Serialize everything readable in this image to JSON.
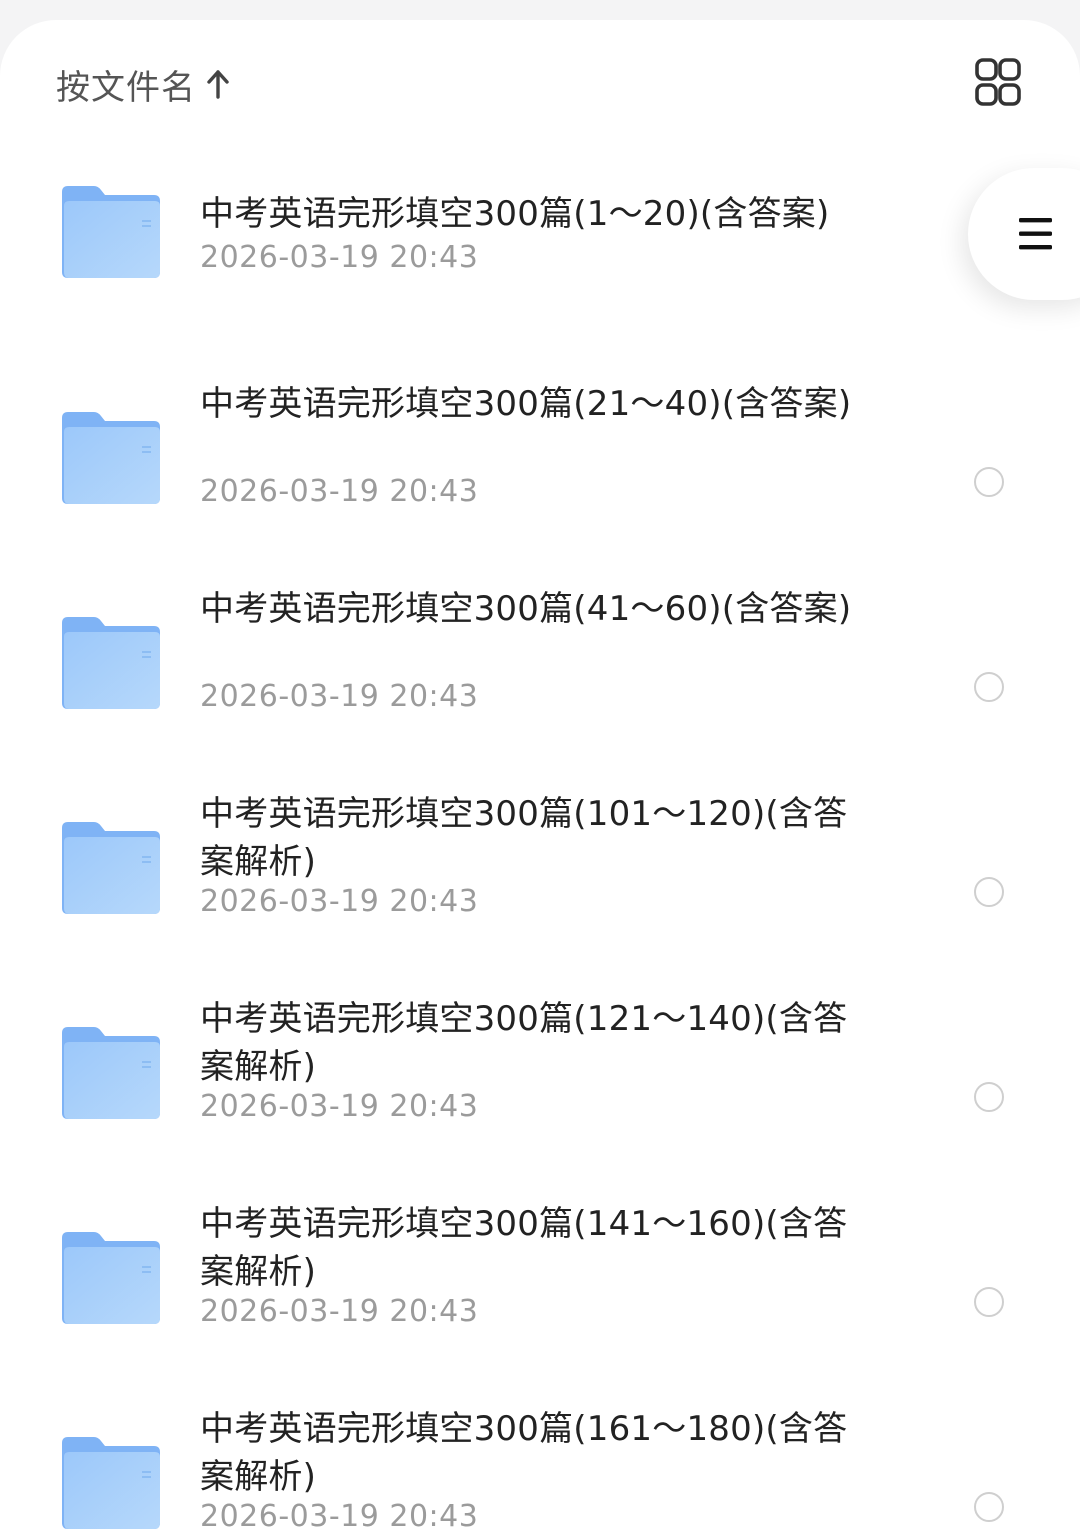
{
  "toolbar": {
    "sort_label": "按文件名",
    "sort_direction_icon": "arrow-up-icon",
    "view_toggle_icon": "grid-view-icon",
    "menu_icon": "hamburger-menu-icon"
  },
  "colors": {
    "folder_top": "#7fb3f5",
    "folder_front": "#9cc8fa",
    "title_text": "#222222",
    "date_text": "#9b9b9b",
    "radio_border": "#cfcfcf"
  },
  "files": [
    {
      "name": "中考英语完形填空300篇(1～20)(含答案)",
      "date": "2026-03-19 20:43"
    },
    {
      "name": "中考英语完形填空300篇(21～40)(含答案)",
      "date": "2026-03-19 20:43"
    },
    {
      "name": "中考英语完形填空300篇(41～60)(含答案)",
      "date": "2026-03-19 20:43"
    },
    {
      "name": "中考英语完形填空300篇(101～120)(含答案解析)",
      "date": "2026-03-19 20:43"
    },
    {
      "name": "中考英语完形填空300篇(121～140)(含答案解析)",
      "date": "2026-03-19 20:43"
    },
    {
      "name": "中考英语完形填空300篇(141～160)(含答案解析)",
      "date": "2026-03-19 20:43"
    },
    {
      "name": "中考英语完形填空300篇(161～180)(含答案解析)",
      "date": "2026-03-19 20:43"
    }
  ]
}
